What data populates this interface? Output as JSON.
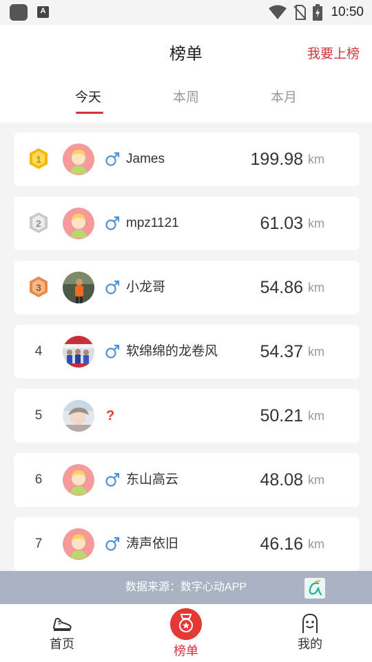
{
  "status_bar": {
    "time": "10:50",
    "icons": [
      "app-icon",
      "a-icon",
      "wifi-icon",
      "no-sim-icon",
      "battery-charging-icon"
    ]
  },
  "header": {
    "title": "榜单",
    "action_label": "我要上榜",
    "tabs": [
      {
        "label": "今天",
        "active": true
      },
      {
        "label": "本周",
        "active": false
      },
      {
        "label": "本月",
        "active": false
      }
    ]
  },
  "leaderboard": [
    {
      "rank": "1",
      "medal": "gold",
      "avatar": "default-avatar",
      "gender": "male",
      "name": "James",
      "distance": "199.98",
      "unit": "km"
    },
    {
      "rank": "2",
      "medal": "silver",
      "avatar": "default-avatar",
      "gender": "male",
      "name": "mpz1121",
      "distance": "61.03",
      "unit": "km"
    },
    {
      "rank": "3",
      "medal": "bronze",
      "avatar": "photo-avatar",
      "gender": "male",
      "name": "小龙哥",
      "distance": "54.86",
      "unit": "km"
    },
    {
      "rank": "4",
      "medal": "",
      "avatar": "photo-avatar",
      "gender": "male",
      "name": "软绵绵的龙卷风",
      "distance": "54.37",
      "unit": "km"
    },
    {
      "rank": "5",
      "medal": "",
      "avatar": "photo-avatar",
      "gender": "unknown",
      "gender_mark": "?",
      "name": "",
      "distance": "50.21",
      "unit": "km"
    },
    {
      "rank": "6",
      "medal": "",
      "avatar": "default-avatar",
      "gender": "male",
      "name": "东山高云",
      "distance": "48.08",
      "unit": "km"
    },
    {
      "rank": "7",
      "medal": "",
      "avatar": "default-avatar",
      "gender": "male",
      "name": "涛声依旧",
      "distance": "46.16",
      "unit": "km"
    }
  ],
  "source_bar": {
    "text": "数据来源：数字心动APP",
    "logo_icon": "digital-heart-logo-icon"
  },
  "bottom_nav": [
    {
      "label": "首页",
      "icon": "shoe-icon",
      "active": false
    },
    {
      "label": "榜单",
      "icon": "medal-icon",
      "active": true
    },
    {
      "label": "我的",
      "icon": "smiley-icon",
      "active": false
    }
  ],
  "colors": {
    "accent": "#d5343c",
    "gender_male": "#4a90e2",
    "gold": "#f5b800",
    "silver": "#c9c9c9",
    "bronze": "#e08a4e",
    "source_bar": "#a9b3c2"
  }
}
